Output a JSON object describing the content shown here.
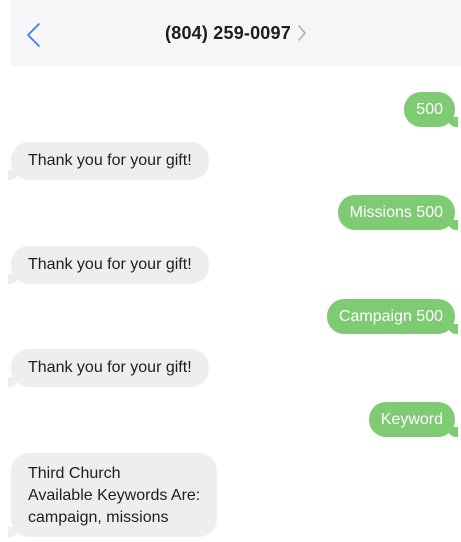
{
  "header": {
    "back_icon": "chevron-left-icon",
    "title": "(804) 259-0097",
    "title_icon": "chevron-right-icon",
    "accent_color": "#2f7cf6"
  },
  "conversation": {
    "sent_color": "#7fcb74",
    "received_color": "#eeeef0",
    "messages": [
      {
        "direction": "sent",
        "text": "500"
      },
      {
        "direction": "received",
        "text": "Thank you for your gift!"
      },
      {
        "direction": "sent",
        "text": "Missions 500"
      },
      {
        "direction": "received",
        "text": "Thank you for your gift!"
      },
      {
        "direction": "sent",
        "text": "Campaign 500"
      },
      {
        "direction": "received",
        "text": "Thank you for your gift!"
      },
      {
        "direction": "sent",
        "text": "Keyword"
      },
      {
        "direction": "received",
        "lines": [
          "Third Church",
          "Available Keywords Are:",
          "campaign, missions"
        ]
      }
    ]
  }
}
